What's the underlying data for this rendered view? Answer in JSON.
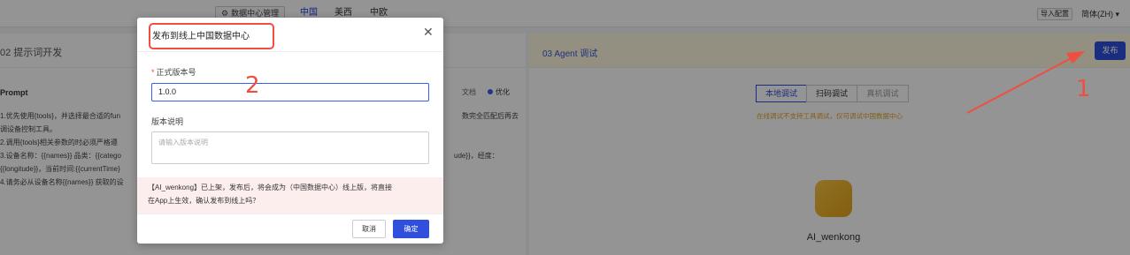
{
  "topbar": {
    "data_center_btn": "数据中心管理",
    "regions": [
      "中国",
      "美西",
      "中欧"
    ],
    "import_btn": "导入配置",
    "language": "简体(ZH)"
  },
  "left": {
    "title": "02  提示词开发",
    "prompt_label": "Prompt",
    "doc_link": "文档",
    "optimize": "优化",
    "prompt_lines": [
      "1.优先使用{tools}，并选择最合适的fun",
      "调设备控制工具。",
      "2.调用{tools}相关参数的时必须严格遵",
      "3.设备名称：{{names}} 品类：{{catego",
      "{{longitude}}，当前时间:{{currentTime}",
      "4.请务必从设备名称{{names}} 获取的设"
    ],
    "prompt_right_1": "数完全匹配后再去",
    "prompt_right_2": "ude}}，经度："
  },
  "right": {
    "title": "03  Agent 调试",
    "publish_btn": "发布",
    "tabs": [
      "本地调试",
      "扫码调试",
      "真机调试"
    ],
    "tab_note": "在线调试不支持工具调试，仅可调试中国数据中心",
    "agent_name": "AI_wenkong"
  },
  "dialog": {
    "title": "发布到线上中国数据中心",
    "version_label": "正式版本号",
    "version_value": "1.0.0",
    "desc_label": "版本说明",
    "desc_placeholder": "请输入版本说明",
    "warning_line1": "【AI_wenkong】已上架，发布后，将会成为（中国数据中心）线上版，将直接",
    "warning_line2": "在App上生效，确认发布到线上吗？",
    "cancel": "取消",
    "confirm": "确定"
  },
  "annotations": {
    "label_1": "1",
    "label_2": "2",
    "color": "#ef4f3f"
  }
}
